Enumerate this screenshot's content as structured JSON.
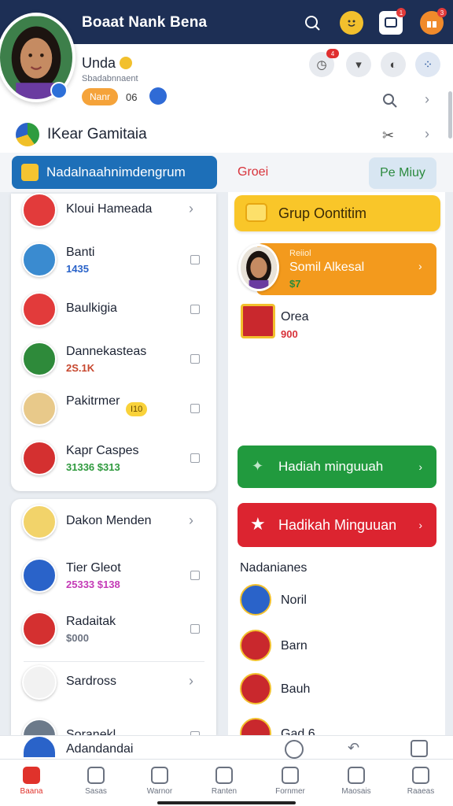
{
  "header": {
    "title": "Boaat Nank Bena"
  },
  "profile": {
    "name": "Unda",
    "subtitle": "Sbadabnnaent",
    "pill": "Nanr",
    "level": "06",
    "notify_badge": "4"
  },
  "group": {
    "title": "IKear Gamitaia"
  },
  "tabs": {
    "active": "Nadalnaahnimdengrum",
    "middle": "Groei",
    "right": "Pe Miuy"
  },
  "left_list": [
    {
      "name": "Kloui Hameada",
      "sub": "",
      "av_color": "#e23b3b",
      "control": "chevron"
    },
    {
      "name": "Banti",
      "sub": "1435",
      "av_color": "#3a8bd0",
      "sub_color": "#2a63c9",
      "control": "checkbox"
    },
    {
      "name": "Baulkigia",
      "sub": "",
      "av_color": "#e23b3b",
      "control": "checkbox"
    },
    {
      "name": "Dannekasteas",
      "sub": "2S.1K",
      "av_color": "#2e8a3a",
      "sub_color": "#c7472e",
      "control": "checkbox"
    },
    {
      "name": "Pakitrmer",
      "sub": "",
      "chip": "I10",
      "av_color": "#e8c98a",
      "control": "checkbox"
    },
    {
      "name": "Kapr Caspes",
      "sub": "31336 $313",
      "av_color": "#d43030",
      "sub_color": "#2f9a3e",
      "control": "checkbox"
    }
  ],
  "left_list2": [
    {
      "name": "Dakon Menden",
      "sub": "",
      "av_color": "#f2d36a",
      "control": "chevron"
    },
    {
      "name": "Tier Gleot",
      "sub": "25333 $138",
      "av_color": "#2a63c9",
      "sub_color": "#c43ab6",
      "control": "checkbox"
    },
    {
      "name": "Radaitak",
      "sub": "$000",
      "av_color": "#d43030",
      "sub_color": "#6b7280",
      "control": "checkbox"
    },
    {
      "name": "Sardross",
      "sub": "",
      "av_color": "#f2f2f2",
      "control": "chevron"
    },
    {
      "name": "Soranekl",
      "sub": "",
      "av_color": "#6c7a8a",
      "sub_color": "#2f9a3e",
      "control": "checkbox"
    }
  ],
  "right": {
    "yellow_card": "Grup Oontitim",
    "orange_card": {
      "small": "Reiiol",
      "name": "Somil Alkesal",
      "value": "$7"
    },
    "item1": {
      "name": "Orea",
      "value": "900"
    },
    "green_button": "Hadiah minguuah",
    "red_button": "Hadikah Minguuan",
    "section_title": "Nadanianes",
    "rows": [
      "Noril",
      "Barn",
      "Bauh",
      "Gad 6"
    ]
  },
  "bottom_strip": {
    "label": "Adandandai"
  },
  "bottom_nav": [
    "Baana",
    "Sasas",
    "Warnor",
    "Ranten",
    "Fornmer",
    "Maosais",
    "Raaeas"
  ],
  "colors": {
    "header": "#1d2f55",
    "primary_blue": "#1d6fb8",
    "green": "#219a3e",
    "red": "#dc2430",
    "yellow": "#f9c629",
    "orange": "#f39a1d"
  },
  "icons": [
    "search-icon",
    "emoji-icon",
    "chat-icon",
    "gift-icon",
    "timer-icon",
    "filter-icon",
    "moon-icon",
    "apps-icon",
    "chevron-right-icon",
    "share-icon",
    "home-icon",
    "profile-icon"
  ]
}
